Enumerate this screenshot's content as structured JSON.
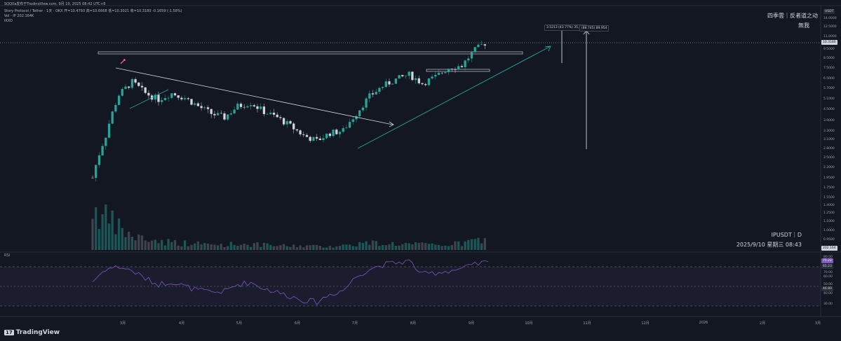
{
  "header": {
    "line1": "SQQ0a发布于TradingView.com, 9月 10, 2025 08:42 UTC+8",
    "line2": "Story Protocol / Tether · 1天 · OKX  开=10.4793  高=10.6668  低=10.3021  收=10.3180  -0.1659 (-1.58%)",
    "line3": "Vol · IP  202.164K",
    "line4": "IKXO"
  },
  "watermark": {
    "line1": "四季雲｜反者道之动",
    "line2": "無我",
    "symbol": "IPUSDT｜D",
    "datetime": "2025/9/10 星期三 08:43"
  },
  "price_axis": {
    "currency": "USDT",
    "ticks": [
      "14.0000",
      "12.5000",
      "11.0000",
      "9.5000",
      "8.5000",
      "7.5000",
      "6.5000",
      "5.7000",
      "5.1000",
      "4.5000",
      "3.9000",
      "3.3000",
      "3.1000",
      "2.8000",
      "2.5000",
      "2.2000",
      "1.9500",
      "1.7500",
      "1.5500",
      "1.4000",
      "1.2500",
      "1.1000",
      "1.0000",
      "0.9500"
    ],
    "last_price_label": "10.3180",
    "volume_label": "202.164"
  },
  "rsi_axis": {
    "label": "RSI",
    "ticks": [
      "80.00",
      "70.00",
      "60.00",
      "50.00",
      "40.00",
      "30.00"
    ],
    "value_label": "75.22",
    "upper_label": "65.23",
    "lower_label": "46.80"
  },
  "annotations": {
    "measure_1": "3.5213 (43.77%) 35,213",
    "measure_2": "(88.745) 89,954"
  },
  "time_axis": [
    "3月",
    "4月",
    "5月",
    "6月",
    "7月",
    "8月",
    "9月",
    "10月",
    "11月",
    "12月",
    "2026",
    "2月",
    "3月"
  ],
  "brand": {
    "logo_mark": "17",
    "name": "TradingView"
  },
  "colors": {
    "up": "#26a69a",
    "down": "#d1d4dc",
    "background": "#131722",
    "rsi_line": "#7e57c2",
    "trendline": "#26a69a",
    "arrow": "#d1d4dc"
  },
  "chart_data": [
    {
      "type": "candlestick",
      "title": "Story Protocol / Tether · 1天 · OKX",
      "symbol": "IPUSDT",
      "interval": "1D",
      "ohlc_last": {
        "open": 10.4793,
        "high": 10.6668,
        "low": 10.3021,
        "close": 10.318,
        "change": -0.1659,
        "change_pct": -1.58
      },
      "volume_last": "202.164K",
      "ylabel": "USDT",
      "ylim": [
        0.95,
        14.0
      ],
      "x": [
        "2025-02-13",
        "2025-02-20",
        "2025-02-27",
        "2025-03-06",
        "2025-03-13",
        "2025-03-20",
        "2025-03-27",
        "2025-04-03",
        "2025-04-10",
        "2025-04-17",
        "2025-04-24",
        "2025-05-01",
        "2025-05-08",
        "2025-05-15",
        "2025-05-22",
        "2025-05-29",
        "2025-06-05",
        "2025-06-12",
        "2025-06-19",
        "2025-06-26",
        "2025-07-03",
        "2025-07-10",
        "2025-07-17",
        "2025-07-24",
        "2025-07-31",
        "2025-08-07",
        "2025-08-14",
        "2025-08-21",
        "2025-08-28",
        "2025-09-04",
        "2025-09-10"
      ],
      "series": [
        {
          "name": "close",
          "values": [
            1.9,
            3.2,
            5.3,
            6.2,
            5.4,
            5.0,
            5.4,
            5.1,
            4.6,
            4.2,
            4.0,
            4.6,
            4.8,
            4.3,
            4.0,
            3.6,
            3.2,
            3.0,
            3.3,
            3.4,
            4.2,
            5.2,
            5.9,
            6.4,
            6.8,
            6.1,
            6.6,
            7.4,
            7.6,
            9.2,
            10.318
          ]
        },
        {
          "name": "volume",
          "values": [
            95,
            70,
            50,
            30,
            25,
            20,
            18,
            15,
            14,
            12,
            12,
            14,
            13,
            11,
            10,
            9,
            10,
            8,
            9,
            10,
            14,
            16,
            15,
            14,
            13,
            12,
            11,
            13,
            14,
            22,
            20
          ]
        },
        {
          "name": "RSI",
          "values": [
            55,
            68,
            70,
            66,
            58,
            52,
            55,
            50,
            46,
            44,
            45,
            52,
            54,
            48,
            44,
            40,
            36,
            34,
            42,
            46,
            60,
            68,
            72,
            74,
            76,
            62,
            64,
            66,
            68,
            72,
            75.22
          ]
        }
      ],
      "rsi": {
        "value": 75.22,
        "bands": [
          70,
          30
        ],
        "ylim": [
          25,
          85
        ]
      }
    }
  ]
}
